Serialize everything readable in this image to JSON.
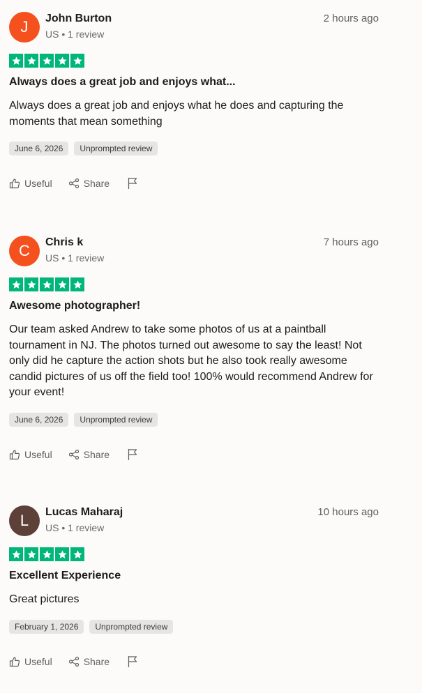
{
  "star_color": "#00b67a",
  "reviews": [
    {
      "avatar_letter": "J",
      "avatar_color": "#f4511e",
      "name": "John Burton",
      "meta": "US • 1 review",
      "time": "2 hours ago",
      "rating": 5,
      "title": "Always does a great job and enjoys what...",
      "body": "Always does a great job and enjoys what he does and capturing the moments that mean something",
      "date": "June 6, 2026",
      "tag": "Unprompted review",
      "useful_label": "Useful",
      "share_label": "Share"
    },
    {
      "avatar_letter": "C",
      "avatar_color": "#f4511e",
      "name": "Chris k",
      "meta": "US • 1 review",
      "time": "7 hours ago",
      "rating": 5,
      "title": "Awesome photographer!",
      "body": "Our team asked Andrew to take some photos of us at a paintball tournament in NJ. The photos turned out awesome to say the least! Not only did he capture the action shots but he also took really awesome candid pictures of us off the field too! 100% would recommend Andrew for your event!",
      "date": "June 6, 2026",
      "tag": "Unprompted review",
      "useful_label": "Useful",
      "share_label": "Share"
    },
    {
      "avatar_letter": "L",
      "avatar_color": "#5d4037",
      "name": "Lucas Maharaj",
      "meta": "US • 1 review",
      "time": "10 hours ago",
      "rating": 5,
      "title": "Excellent Experience",
      "body": "Great pictures",
      "date": "February 1, 2026",
      "tag": "Unprompted review",
      "useful_label": "Useful",
      "share_label": "Share"
    }
  ]
}
